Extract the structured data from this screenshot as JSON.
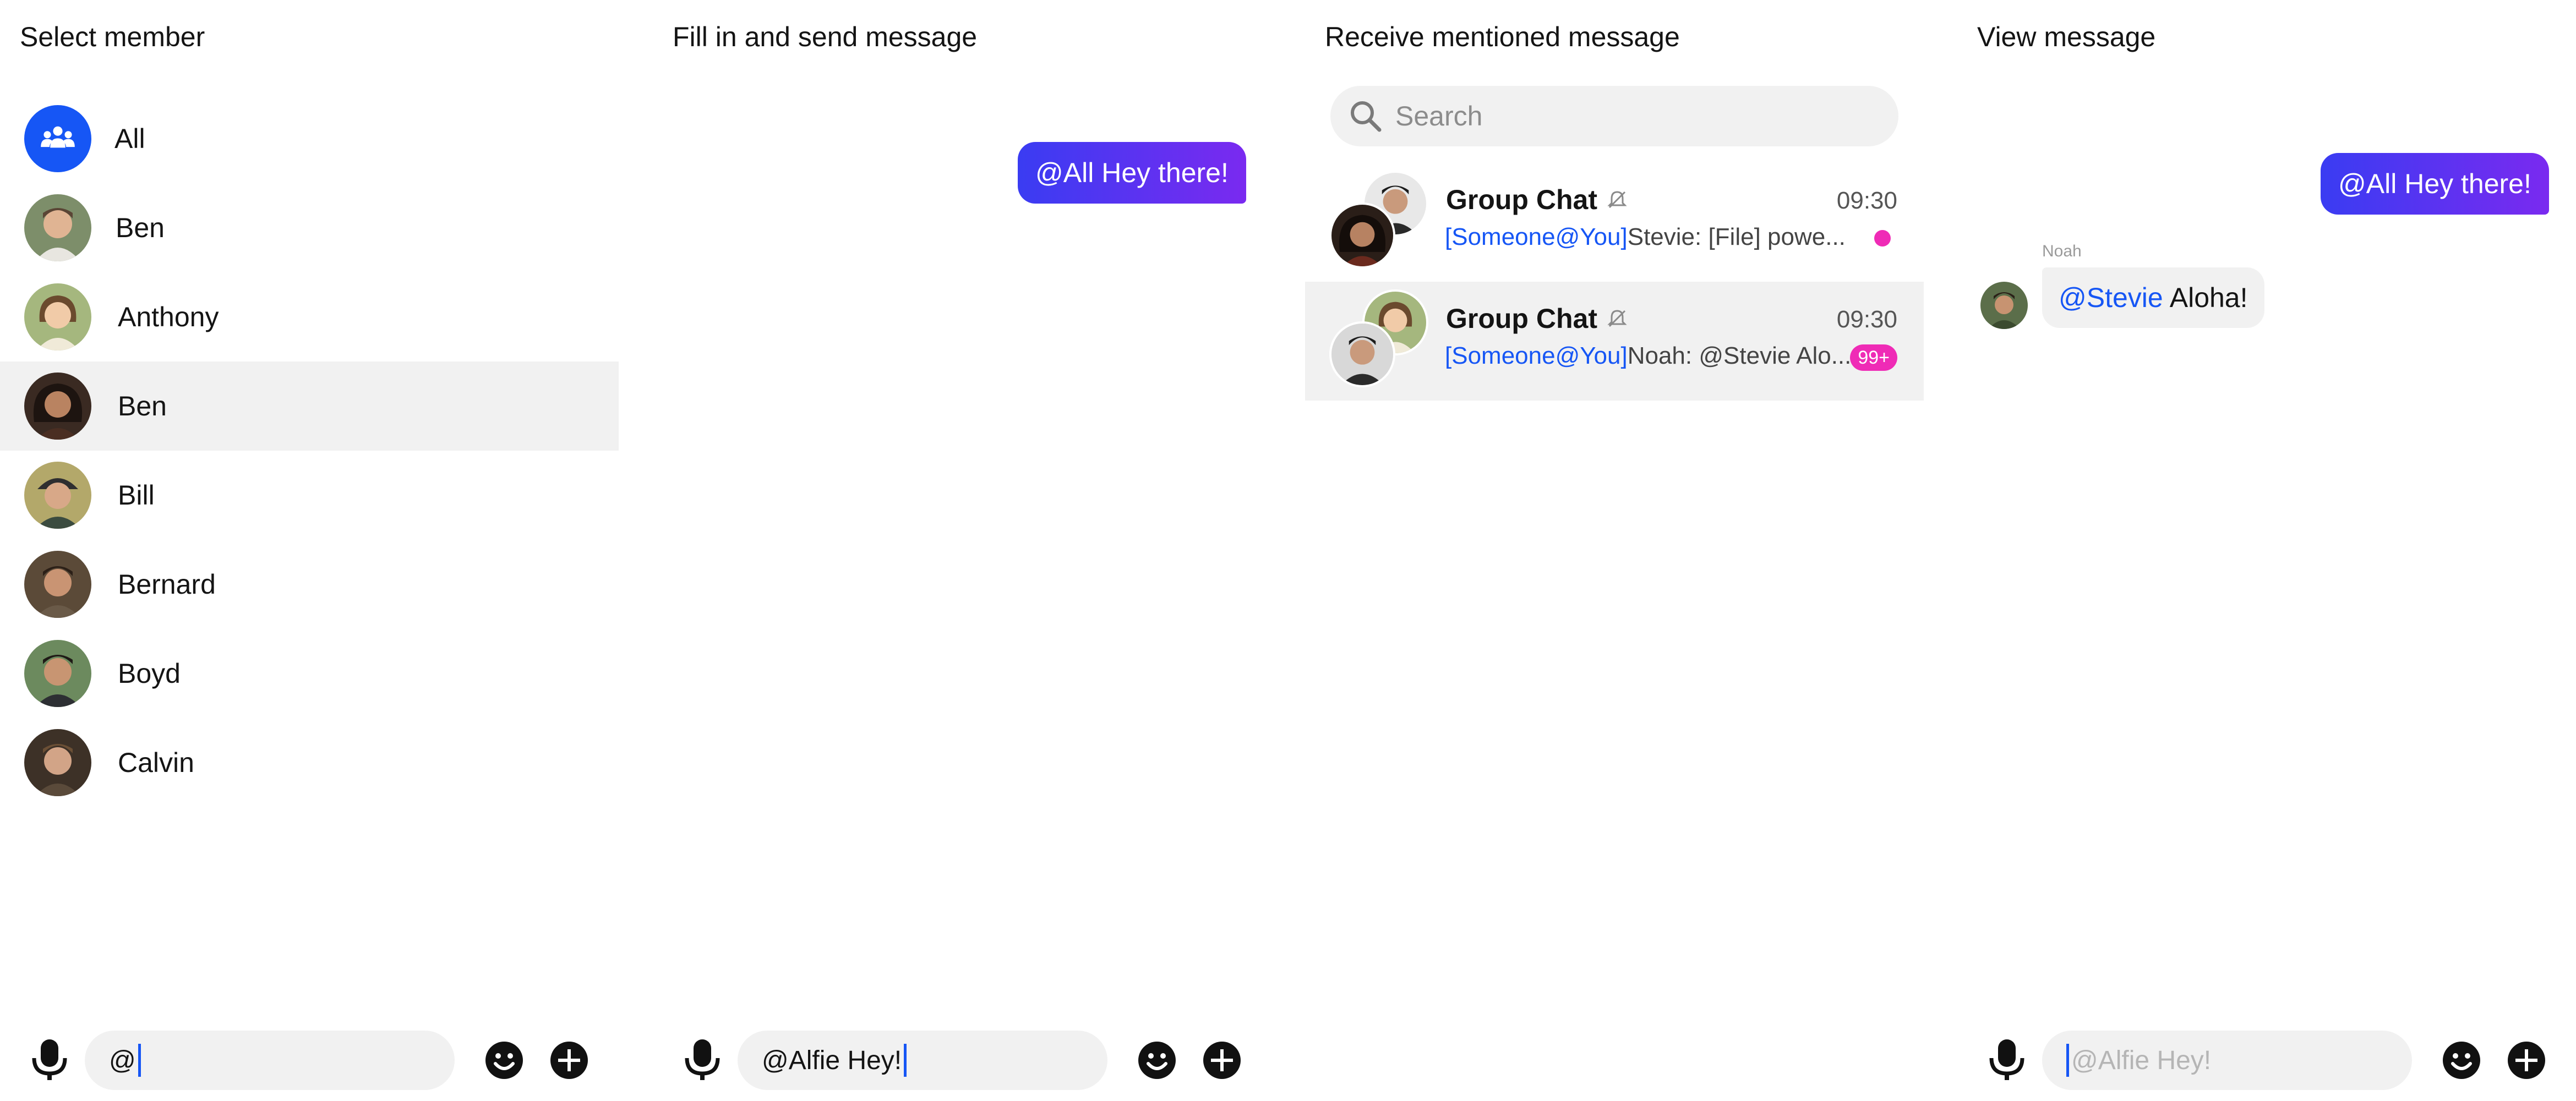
{
  "panels": {
    "select_member": {
      "title": "Select member",
      "members": [
        {
          "name": "All",
          "avatar": "group-icon",
          "selected": false
        },
        {
          "name": "Ben",
          "avatar": "photo",
          "selected": false
        },
        {
          "name": "Anthony",
          "avatar": "photo",
          "selected": false
        },
        {
          "name": "Ben",
          "avatar": "photo",
          "selected": true
        },
        {
          "name": "Bill",
          "avatar": "photo",
          "selected": false
        },
        {
          "name": "Bernard",
          "avatar": "photo",
          "selected": false
        },
        {
          "name": "Boyd",
          "avatar": "photo",
          "selected": false
        },
        {
          "name": "Calvin",
          "avatar": "photo",
          "selected": false
        }
      ],
      "input_value": "@"
    },
    "send_message": {
      "title": "Fill in and send message",
      "sent_message": "@All Hey there!",
      "input_value": "@Alfie Hey!"
    },
    "receive_mention": {
      "title": "Receive mentioned message",
      "search_placeholder": "Search",
      "chats": [
        {
          "name": "Group Chat",
          "time": "09:30",
          "mention_tag": "[Someone@You]",
          "preview": "Stevie: [File] powe...",
          "badge": "dot",
          "muted": true
        },
        {
          "name": "Group Chat",
          "time": "09:30",
          "mention_tag": "[Someone@You]",
          "preview": "Noah: @Stevie Alo...",
          "badge": "99+",
          "muted": true
        }
      ]
    },
    "view_message": {
      "title": "View message",
      "sent_message": "@All Hey there!",
      "sender": "Noah",
      "received_mention": "@Stevie",
      "received_text": "Aloha!",
      "input_placeholder": "@Alfie Hey!"
    }
  },
  "colors": {
    "accent": "#1656f5",
    "bubble_gradient_start": "#3a3cf2",
    "bubble_gradient_end": "#7a2af0",
    "badge": "#ef2bb6",
    "selected_row": "#f1f1f1"
  }
}
